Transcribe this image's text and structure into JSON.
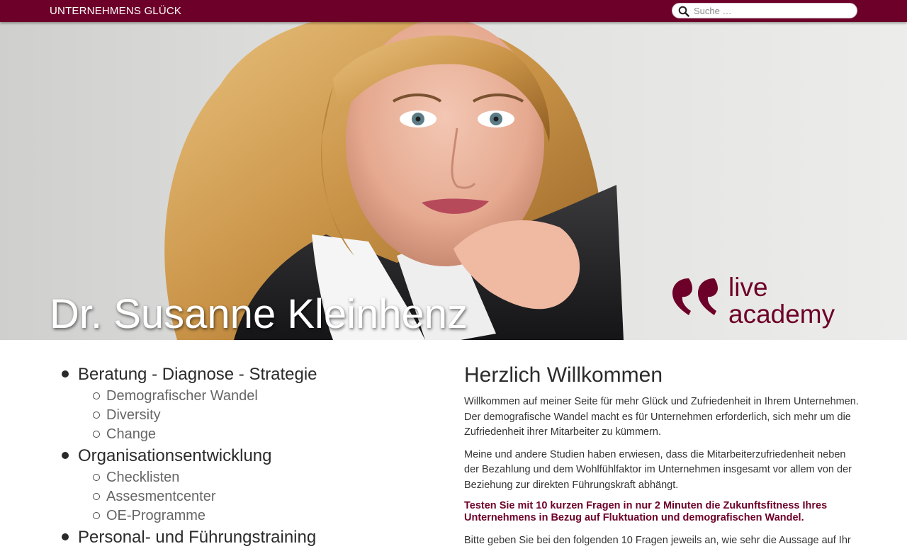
{
  "header": {
    "brand": "UNTERNEHMENS GLÜCK",
    "search_placeholder": "Suche …"
  },
  "hero": {
    "name": "Dr. Susanne Kleinhenz",
    "logo_line1": "live",
    "logo_line2": "academy",
    "icons": {
      "search": "search-icon",
      "logo_mark": "quote-mark-icon"
    }
  },
  "nav": {
    "items": [
      {
        "label": "Beratung - Diagnose - Strategie",
        "children": [
          "Demografischer Wandel",
          "Diversity",
          "Change"
        ]
      },
      {
        "label": "Organisationsentwicklung",
        "children": [
          "Checklisten",
          "Assesmentcenter",
          "OE-Programme"
        ]
      },
      {
        "label": "Personal- und Führungstraining",
        "children": []
      }
    ]
  },
  "content": {
    "title": "Herzlich Willkommen",
    "paragraph1": "Willkommen auf meiner Seite für mehr Glück und Zufriedenheit in Ihrem Unternehmen. Der demografische Wandel macht es für Unternehmen erforderlich, sich mehr um die Zufriedenheit ihrer Mitarbeiter zu kümmern.",
    "paragraph2": "Meine und andere Studien haben erwiesen, dass die Mitarbeiterzufriedenheit neben der Bezahlung und dem Wohlfühlfaktor im Unternehmen insgesamt vor allem von der Beziehung zur direkten Führungskraft abhängt.",
    "highlight": "Testen Sie mit 10 kurzen Fragen in nur 2 Minuten die Zukunftsfitness Ihres Unternehmens in Bezug auf Fluktuation und demografischen Wandel.",
    "paragraph3": "Bitte geben Sie bei den folgenden 10 Fragen jeweils an, wie sehr die Aussage auf Ihr"
  },
  "colors": {
    "brand": "#6d0028",
    "text": "#333333",
    "sublink": "#666666"
  }
}
